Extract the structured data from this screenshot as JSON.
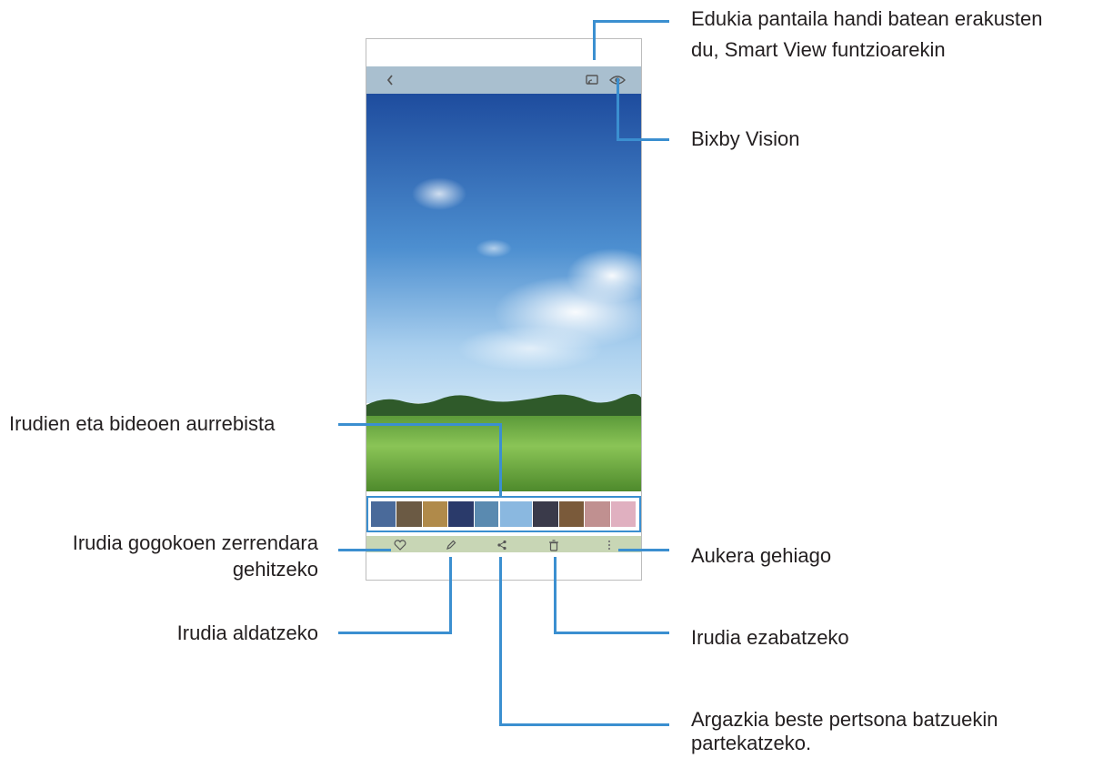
{
  "callouts": {
    "smart_view": {
      "line1": "Edukia pantaila handi batean erakusten",
      "line2": "du, Smart View funtzioarekin"
    },
    "bixby_vision": "Bixby Vision",
    "preview": "Irudien eta bideoen aurrebista",
    "favorite": {
      "line1": "Irudia gogokoen zerrendara",
      "line2": "gehitzeko"
    },
    "more_options": "Aukera gehiago",
    "edit": "Irudia aldatzeko",
    "delete": "Irudia ezabatzeko",
    "share": {
      "line1": "Argazkia beste pertsona batzuekin",
      "line2": "partekatzeko."
    }
  },
  "icons": {
    "back": "back-chevron-icon",
    "smart_view": "smart-view-cast-icon",
    "bixby_vision": "eye-icon",
    "favorite": "heart-icon",
    "edit": "pencil-icon",
    "share": "share-icon",
    "delete": "trash-icon",
    "more": "more-vertical-icon"
  },
  "colors": {
    "callout_line": "#3b8fd0",
    "top_bar": "#a9bfcf",
    "bottom_bar": "#c8d6b5",
    "text": "#231f20"
  },
  "thumbnails": [
    {
      "color": "#4a6a9a"
    },
    {
      "color": "#6b5a44"
    },
    {
      "color": "#b08a4a"
    },
    {
      "color": "#2a3a6a"
    },
    {
      "color": "#5a8ab0"
    },
    {
      "color": "#8ab8e0",
      "selected": true
    },
    {
      "color": "#3a3a4a"
    },
    {
      "color": "#7a5a3a"
    },
    {
      "color": "#c09090"
    },
    {
      "color": "#e0b0c0"
    }
  ]
}
